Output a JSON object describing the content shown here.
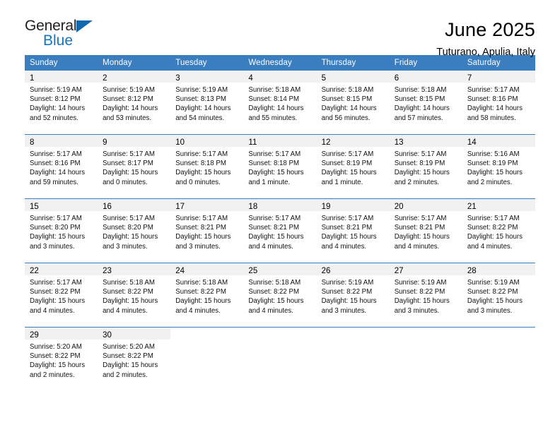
{
  "brand": {
    "name_top": "General",
    "name_bottom": "Blue",
    "accent_color": "#1169ad",
    "text_color": "#231f20"
  },
  "header": {
    "title": "June 2025",
    "subtitle": "Tuturano, Apulia, Italy"
  },
  "theme": {
    "header_row_bg": "#3a7ebf",
    "header_row_text": "#ffffff",
    "daynum_band_bg": "#f1f1f1",
    "week_separator": "#3a7ebf"
  },
  "weekdays": [
    "Sunday",
    "Monday",
    "Tuesday",
    "Wednesday",
    "Thursday",
    "Friday",
    "Saturday"
  ],
  "labels": {
    "sunrise": "Sunrise:",
    "sunset": "Sunset:",
    "daylight": "Daylight:"
  },
  "weeks": [
    [
      {
        "day": "1",
        "sunrise": "Sunrise: 5:19 AM",
        "sunset": "Sunset: 8:12 PM",
        "daylight": "Daylight: 14 hours and 52 minutes."
      },
      {
        "day": "2",
        "sunrise": "Sunrise: 5:19 AM",
        "sunset": "Sunset: 8:12 PM",
        "daylight": "Daylight: 14 hours and 53 minutes."
      },
      {
        "day": "3",
        "sunrise": "Sunrise: 5:19 AM",
        "sunset": "Sunset: 8:13 PM",
        "daylight": "Daylight: 14 hours and 54 minutes."
      },
      {
        "day": "4",
        "sunrise": "Sunrise: 5:18 AM",
        "sunset": "Sunset: 8:14 PM",
        "daylight": "Daylight: 14 hours and 55 minutes."
      },
      {
        "day": "5",
        "sunrise": "Sunrise: 5:18 AM",
        "sunset": "Sunset: 8:15 PM",
        "daylight": "Daylight: 14 hours and 56 minutes."
      },
      {
        "day": "6",
        "sunrise": "Sunrise: 5:18 AM",
        "sunset": "Sunset: 8:15 PM",
        "daylight": "Daylight: 14 hours and 57 minutes."
      },
      {
        "day": "7",
        "sunrise": "Sunrise: 5:17 AM",
        "sunset": "Sunset: 8:16 PM",
        "daylight": "Daylight: 14 hours and 58 minutes."
      }
    ],
    [
      {
        "day": "8",
        "sunrise": "Sunrise: 5:17 AM",
        "sunset": "Sunset: 8:16 PM",
        "daylight": "Daylight: 14 hours and 59 minutes."
      },
      {
        "day": "9",
        "sunrise": "Sunrise: 5:17 AM",
        "sunset": "Sunset: 8:17 PM",
        "daylight": "Daylight: 15 hours and 0 minutes."
      },
      {
        "day": "10",
        "sunrise": "Sunrise: 5:17 AM",
        "sunset": "Sunset: 8:18 PM",
        "daylight": "Daylight: 15 hours and 0 minutes."
      },
      {
        "day": "11",
        "sunrise": "Sunrise: 5:17 AM",
        "sunset": "Sunset: 8:18 PM",
        "daylight": "Daylight: 15 hours and 1 minute."
      },
      {
        "day": "12",
        "sunrise": "Sunrise: 5:17 AM",
        "sunset": "Sunset: 8:19 PM",
        "daylight": "Daylight: 15 hours and 1 minute."
      },
      {
        "day": "13",
        "sunrise": "Sunrise: 5:17 AM",
        "sunset": "Sunset: 8:19 PM",
        "daylight": "Daylight: 15 hours and 2 minutes."
      },
      {
        "day": "14",
        "sunrise": "Sunrise: 5:16 AM",
        "sunset": "Sunset: 8:19 PM",
        "daylight": "Daylight: 15 hours and 2 minutes."
      }
    ],
    [
      {
        "day": "15",
        "sunrise": "Sunrise: 5:17 AM",
        "sunset": "Sunset: 8:20 PM",
        "daylight": "Daylight: 15 hours and 3 minutes."
      },
      {
        "day": "16",
        "sunrise": "Sunrise: 5:17 AM",
        "sunset": "Sunset: 8:20 PM",
        "daylight": "Daylight: 15 hours and 3 minutes."
      },
      {
        "day": "17",
        "sunrise": "Sunrise: 5:17 AM",
        "sunset": "Sunset: 8:21 PM",
        "daylight": "Daylight: 15 hours and 3 minutes."
      },
      {
        "day": "18",
        "sunrise": "Sunrise: 5:17 AM",
        "sunset": "Sunset: 8:21 PM",
        "daylight": "Daylight: 15 hours and 4 minutes."
      },
      {
        "day": "19",
        "sunrise": "Sunrise: 5:17 AM",
        "sunset": "Sunset: 8:21 PM",
        "daylight": "Daylight: 15 hours and 4 minutes."
      },
      {
        "day": "20",
        "sunrise": "Sunrise: 5:17 AM",
        "sunset": "Sunset: 8:21 PM",
        "daylight": "Daylight: 15 hours and 4 minutes."
      },
      {
        "day": "21",
        "sunrise": "Sunrise: 5:17 AM",
        "sunset": "Sunset: 8:22 PM",
        "daylight": "Daylight: 15 hours and 4 minutes."
      }
    ],
    [
      {
        "day": "22",
        "sunrise": "Sunrise: 5:17 AM",
        "sunset": "Sunset: 8:22 PM",
        "daylight": "Daylight: 15 hours and 4 minutes."
      },
      {
        "day": "23",
        "sunrise": "Sunrise: 5:18 AM",
        "sunset": "Sunset: 8:22 PM",
        "daylight": "Daylight: 15 hours and 4 minutes."
      },
      {
        "day": "24",
        "sunrise": "Sunrise: 5:18 AM",
        "sunset": "Sunset: 8:22 PM",
        "daylight": "Daylight: 15 hours and 4 minutes."
      },
      {
        "day": "25",
        "sunrise": "Sunrise: 5:18 AM",
        "sunset": "Sunset: 8:22 PM",
        "daylight": "Daylight: 15 hours and 4 minutes."
      },
      {
        "day": "26",
        "sunrise": "Sunrise: 5:19 AM",
        "sunset": "Sunset: 8:22 PM",
        "daylight": "Daylight: 15 hours and 3 minutes."
      },
      {
        "day": "27",
        "sunrise": "Sunrise: 5:19 AM",
        "sunset": "Sunset: 8:22 PM",
        "daylight": "Daylight: 15 hours and 3 minutes."
      },
      {
        "day": "28",
        "sunrise": "Sunrise: 5:19 AM",
        "sunset": "Sunset: 8:22 PM",
        "daylight": "Daylight: 15 hours and 3 minutes."
      }
    ],
    [
      {
        "day": "29",
        "sunrise": "Sunrise: 5:20 AM",
        "sunset": "Sunset: 8:22 PM",
        "daylight": "Daylight: 15 hours and 2 minutes."
      },
      {
        "day": "30",
        "sunrise": "Sunrise: 5:20 AM",
        "sunset": "Sunset: 8:22 PM",
        "daylight": "Daylight: 15 hours and 2 minutes."
      },
      {
        "day": "",
        "sunrise": "",
        "sunset": "",
        "daylight": ""
      },
      {
        "day": "",
        "sunrise": "",
        "sunset": "",
        "daylight": ""
      },
      {
        "day": "",
        "sunrise": "",
        "sunset": "",
        "daylight": ""
      },
      {
        "day": "",
        "sunrise": "",
        "sunset": "",
        "daylight": ""
      },
      {
        "day": "",
        "sunrise": "",
        "sunset": "",
        "daylight": ""
      }
    ]
  ]
}
